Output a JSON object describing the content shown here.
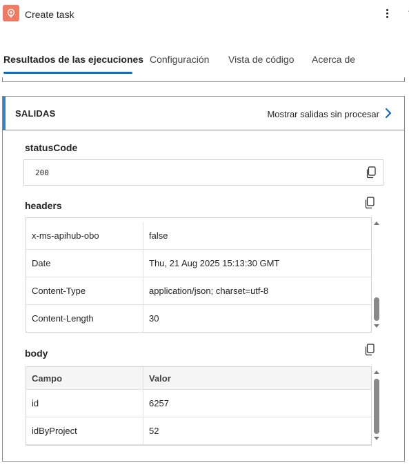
{
  "header": {
    "title": "Create task",
    "more_icon": "more-vertical-icon",
    "app_icon": "app-logo-icon",
    "accent": "#f07b63"
  },
  "tabs": [
    {
      "label": "Resultados de las ejecuciones",
      "active": true
    },
    {
      "label": "Configuración",
      "active": false
    },
    {
      "label": "Vista de código",
      "active": false
    },
    {
      "label": "Acerca de",
      "active": false
    }
  ],
  "outputs": {
    "title": "SALIDAS",
    "raw_link": "Mostrar salidas sin procesar",
    "status_code": {
      "label": "statusCode",
      "value": "200"
    },
    "headers": {
      "label": "headers",
      "rows": [
        {
          "key": "x-ms-apihub-obo",
          "value": "false"
        },
        {
          "key": "Date",
          "value": "Thu, 21 Aug 2025 15:13:30 GMT"
        },
        {
          "key": "Content-Type",
          "value": "application/json; charset=utf-8"
        },
        {
          "key": "Content-Length",
          "value": "30"
        }
      ]
    },
    "body": {
      "label": "body",
      "columns": [
        "Campo",
        "Valor"
      ],
      "rows": [
        {
          "key": "id",
          "value": "6257"
        },
        {
          "key": "idByProject",
          "value": "52"
        }
      ]
    }
  },
  "colors": {
    "tab_underline": "#0f6cbd",
    "panel_accent": "#3a7fc1",
    "link_chevron": "#0f6cbd"
  }
}
